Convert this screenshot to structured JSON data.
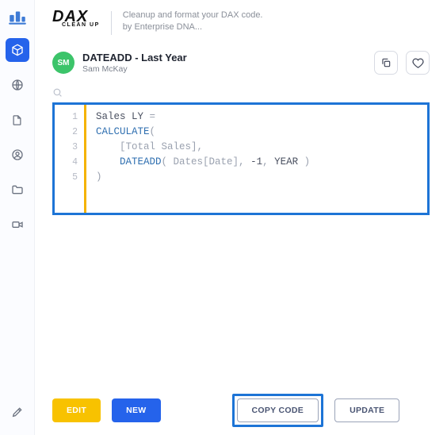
{
  "brand": {
    "title": "DAX",
    "subtitle": "CLEAN UP"
  },
  "tagline": {
    "line1": "Cleanup and format your DAX code.",
    "line2": "by Enterprise DNA..."
  },
  "doc": {
    "title": "DATEADD - Last Year",
    "author": "Sam McKay",
    "avatar_initials": "SM"
  },
  "editor": {
    "lines": [
      "1",
      "2",
      "3",
      "4",
      "5"
    ],
    "code": {
      "l1_a": "Sales LY ",
      "l1_b": "=",
      "l2_a": "CALCULATE",
      "l2_b": "(",
      "l3_a": "    [Total Sales]",
      "l3_b": ",",
      "l4_a": "    ",
      "l4_b": "DATEADD",
      "l4_c": "( Dates[Date], ",
      "l4_d": "-1",
      "l4_e": ", ",
      "l4_f": "YEAR",
      "l4_g": " )",
      "l5_a": ")"
    }
  },
  "buttons": {
    "edit": "EDIT",
    "new": "NEW",
    "copy": "COPY CODE",
    "update": "UPDATE"
  }
}
